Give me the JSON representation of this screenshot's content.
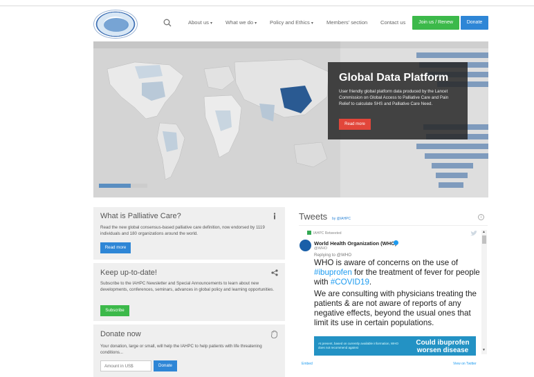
{
  "header": {
    "logo_name": "iahpc-logo",
    "nav": [
      {
        "label": "About us",
        "dropdown": true
      },
      {
        "label": "What we do",
        "dropdown": true
      },
      {
        "label": "Policy and Ethics",
        "dropdown": true
      },
      {
        "label": "Members' section",
        "dropdown": false
      },
      {
        "label": "Contact us",
        "dropdown": false
      }
    ],
    "join_label": "Join us / Renew",
    "donate_label": "Donate",
    "colors": {
      "join": "#3cb94a",
      "donate": "#2e86d6"
    }
  },
  "hero": {
    "title": "Global Data Platform",
    "text": "User friendly global platform data produced by the Lancet Commission on Global Access to Palliative Care and Pain Relief to calculate SHS and Palliative Care Need.",
    "button_label": "Read more",
    "button_color": "#e2463a"
  },
  "palliative": {
    "title": "What is Palliative Care?",
    "icon": "info-icon",
    "text": "Read the new global consensus-based palliative care definition, now endorsed by 1119 individuals and 180 organizations around the world.",
    "button_label": "Read more"
  },
  "newsletter": {
    "title": "Keep up-to-date!",
    "icon": "share-icon",
    "text": "Subscribe to the IAHPC Newsletter and Special Announcements to learn about new developments, conferences, seminars, advances in global policy and learning opportunities.",
    "button_label": "Subscribe"
  },
  "donate": {
    "title": "Donate now",
    "icon": "hand-icon",
    "text": "Your donation, large or small, will help the IAHPC to help patients with life threatening conditions...",
    "placeholder": "Amount in US$",
    "button_label": "Donate"
  },
  "tweets": {
    "title": "Tweets",
    "by": "by @IAHPC",
    "retweeted": "IAHPC Retweeted",
    "author_name": "World Health Organization (WHO)",
    "author_handle": "@WHO",
    "replying": "Replying to @WHO",
    "body_1a": "WHO is aware of concerns on the use of ",
    "tag_1": "#ibuprofen",
    "body_1b": " for the treatment of fever for people with ",
    "tag_2": "#COVID19",
    "body_1c": ".",
    "body_2": "We are consulting with physicians treating the patients & are not aware of reports of any negative effects, beyond the usual ones that limit its use in certain populations.",
    "image_big": "Could ibuprofen worsen disease",
    "image_small": "At present, based on currently available information, WHO does not recommend against",
    "embed": "Embed",
    "view": "View on Twitter"
  }
}
